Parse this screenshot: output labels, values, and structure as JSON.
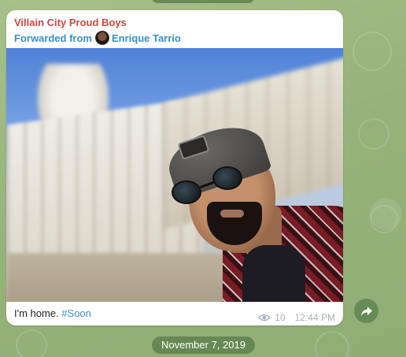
{
  "message": {
    "sender": "Villain City Proud Boys",
    "forwarded_prefix": "Forwarded from",
    "forwarded_name": "Enrique Tarrio",
    "caption_text": "I'm home.",
    "caption_hashtag": "#Soon",
    "views": "10",
    "time": "12:44 PM"
  },
  "date_separator": "November 7, 2019",
  "colors": {
    "sender": "#c9483f",
    "link": "#3a8fc7",
    "chat_background": "#9bb67e"
  },
  "icons": {
    "views": "eye-icon",
    "share": "share-arrow-icon"
  }
}
